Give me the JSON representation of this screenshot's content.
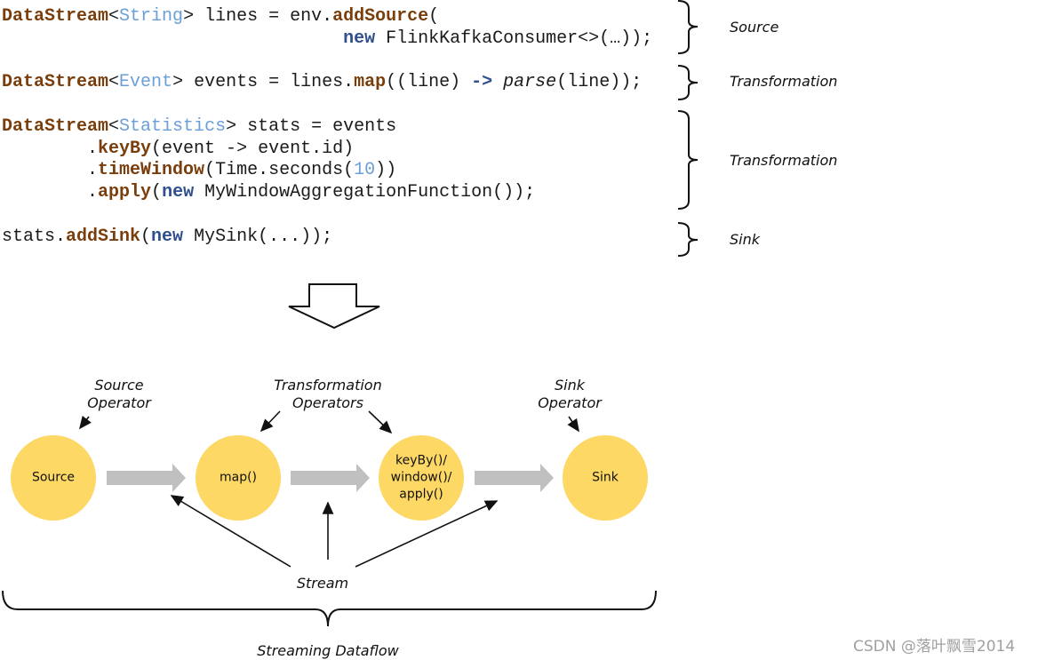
{
  "code_lines": [
    [
      [
        "DataStream",
        "kw"
      ],
      [
        "<",
        ""
      ],
      [
        "String",
        "ty"
      ],
      [
        "> lines = env.",
        ""
      ],
      [
        "addSource",
        "kw"
      ],
      [
        "(",
        ""
      ]
    ],
    [
      [
        "                                ",
        ""
      ],
      [
        "new",
        "nw"
      ],
      [
        " FlinkKafkaConsumer<>(…));",
        ""
      ]
    ],
    [
      [
        "DataStream",
        "kw"
      ],
      [
        "<",
        ""
      ],
      [
        "Event",
        "ty"
      ],
      [
        "> events = lines.",
        ""
      ],
      [
        "map",
        "kw"
      ],
      [
        "((line) ",
        ""
      ],
      [
        "->",
        "nw"
      ],
      [
        " ",
        ""
      ],
      [
        "parse",
        "it"
      ],
      [
        "(line));",
        ""
      ]
    ],
    [
      [
        "DataStream",
        "kw"
      ],
      [
        "<",
        ""
      ],
      [
        "Statistics",
        "ty"
      ],
      [
        "> stats = events",
        ""
      ]
    ],
    [
      [
        "        .",
        ""
      ],
      [
        "keyBy",
        "kw"
      ],
      [
        "(event -> event.id)",
        ""
      ]
    ],
    [
      [
        "        .",
        ""
      ],
      [
        "timeWindow",
        "kw"
      ],
      [
        "(Time.seconds(",
        ""
      ],
      [
        "10",
        "ty"
      ],
      [
        "))",
        ""
      ]
    ],
    [
      [
        "        .",
        ""
      ],
      [
        "apply",
        "kw"
      ],
      [
        "(",
        ""
      ],
      [
        "new",
        "nw"
      ],
      [
        " MyWindowAggregationFunction());",
        ""
      ]
    ],
    [
      [
        "stats.",
        ""
      ],
      [
        "addSink",
        "kw"
      ],
      [
        "(",
        ""
      ],
      [
        "new",
        "nw"
      ],
      [
        " MySink(...));",
        ""
      ]
    ]
  ],
  "brace_labels": [
    "Source",
    "Transformation",
    "Transformation",
    "Sink"
  ],
  "operator_labels": {
    "source": "Source\nOperator",
    "transformation": "Transformation\nOperators",
    "sink": "Sink\nOperator"
  },
  "nodes": [
    "Source",
    "map()",
    "keyBy()/\nwindow()/\napply()",
    "Sink"
  ],
  "stream_label": "Stream",
  "dataflow_label": "Streaming Dataflow",
  "watermark": "CSDN @落叶飘雪2014",
  "colors": {
    "node_fill": "#fdd865",
    "flow_arrow": "#c0c0c0",
    "keyword": "#7a3e0c",
    "type": "#6a9fd8",
    "new_keyword": "#2f4f8f"
  }
}
